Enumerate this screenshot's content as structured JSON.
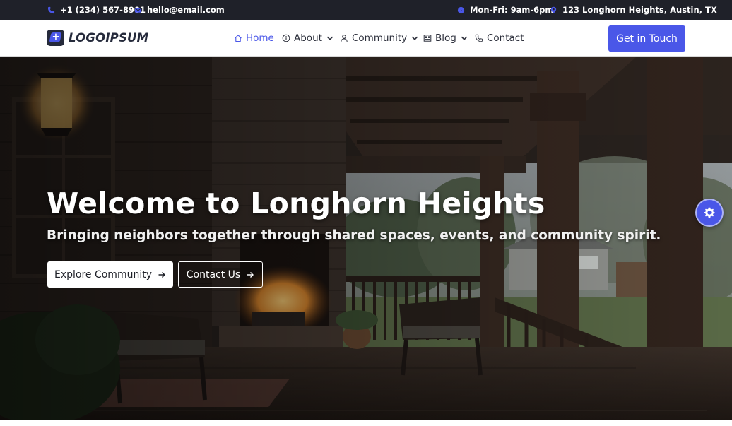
{
  "topbar": {
    "phone": "+1 (234) 567-8901",
    "email": "hello@email.com",
    "hours": "Mon-Fri: 9am-6pm",
    "address": "123 Longhorn Heights, Austin, TX",
    "phone_icon": "phone-icon",
    "email_icon": "envelope-icon",
    "hours_icon": "clock-icon",
    "address_icon": "location-pin-icon"
  },
  "nav": {
    "logo_text": "LOGOIPSUM",
    "items": [
      {
        "label": "Home",
        "icon": "house-icon",
        "active": true
      },
      {
        "label": "About",
        "icon": "info-icon",
        "dropdown": true
      },
      {
        "label": "Community",
        "icon": "users-icon",
        "dropdown": true
      },
      {
        "label": "Blog",
        "icon": "newspaper-icon",
        "dropdown": true
      },
      {
        "label": "Contact",
        "icon": "phone-icon"
      }
    ],
    "cta_label": "Get in Touch"
  },
  "hero": {
    "title": "Welcome to Longhorn Heights",
    "subtitle": "Bringing neighbors together through shared spaces, events, and community spirit.",
    "primary_button": "Explore Community",
    "secondary_button": "Contact Us"
  },
  "colors": {
    "accent": "#4a57e8",
    "topbar_bg": "#1f2129",
    "text_dark": "#2b2e3a"
  }
}
